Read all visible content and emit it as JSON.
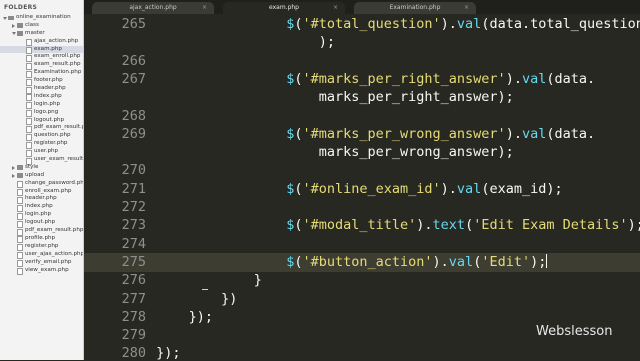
{
  "sidebar": {
    "title": "FOLDERS",
    "items": [
      {
        "label": "online_examination",
        "type": "folder",
        "expanded": true,
        "depth": 0
      },
      {
        "label": "class",
        "type": "folder",
        "expanded": false,
        "depth": 1
      },
      {
        "label": "master",
        "type": "folder",
        "expanded": true,
        "depth": 1
      },
      {
        "label": "ajax_action.php",
        "type": "file",
        "depth": 2
      },
      {
        "label": "exam.php",
        "type": "file",
        "depth": 2,
        "selected": true
      },
      {
        "label": "exam_enroll.php",
        "type": "file",
        "depth": 2
      },
      {
        "label": "exam_result.php",
        "type": "file",
        "depth": 2
      },
      {
        "label": "Examination.php",
        "type": "file",
        "depth": 2
      },
      {
        "label": "footer.php",
        "type": "file",
        "depth": 2
      },
      {
        "label": "header.php",
        "type": "file",
        "depth": 2
      },
      {
        "label": "index.php",
        "type": "file",
        "depth": 2
      },
      {
        "label": "login.php",
        "type": "file",
        "depth": 2
      },
      {
        "label": "logo.png",
        "type": "file",
        "depth": 2
      },
      {
        "label": "logout.php",
        "type": "file",
        "depth": 2
      },
      {
        "label": "pdf_exam_result.ph",
        "type": "file",
        "depth": 2
      },
      {
        "label": "question.php",
        "type": "file",
        "depth": 2
      },
      {
        "label": "register.php",
        "type": "file",
        "depth": 2
      },
      {
        "label": "user.php",
        "type": "file",
        "depth": 2
      },
      {
        "label": "user_exam_result.p",
        "type": "file",
        "depth": 2
      },
      {
        "label": "style",
        "type": "folder",
        "expanded": false,
        "depth": 1
      },
      {
        "label": "upload",
        "type": "folder",
        "expanded": false,
        "depth": 1
      },
      {
        "label": "change_password.ph",
        "type": "file",
        "depth": 1
      },
      {
        "label": "enroll_exam.php",
        "type": "file",
        "depth": 1
      },
      {
        "label": "header.php",
        "type": "file",
        "depth": 1
      },
      {
        "label": "index.php",
        "type": "file",
        "depth": 1
      },
      {
        "label": "login.php",
        "type": "file",
        "depth": 1
      },
      {
        "label": "logout.php",
        "type": "file",
        "depth": 1
      },
      {
        "label": "pdf_exam_result.php",
        "type": "file",
        "depth": 1
      },
      {
        "label": "profile.php",
        "type": "file",
        "depth": 1
      },
      {
        "label": "register.php",
        "type": "file",
        "depth": 1
      },
      {
        "label": "user_ajax_action.php",
        "type": "file",
        "depth": 1
      },
      {
        "label": "verify_email.php",
        "type": "file",
        "depth": 1
      },
      {
        "label": "view_exam.php",
        "type": "file",
        "depth": 1
      }
    ]
  },
  "tabs": [
    {
      "label": "ajax_action.php",
      "active": false
    },
    {
      "label": "exam.php",
      "active": true
    },
    {
      "label": "Examination.php",
      "active": false
    }
  ],
  "tab_close_glyph": "×",
  "editor": {
    "current_line": 275,
    "lines": [
      {
        "num": "265",
        "indent": 17,
        "tokens": [
          [
            "fn",
            "$"
          ],
          [
            "pl",
            "("
          ],
          [
            "str",
            "'#total_question'"
          ],
          [
            "pl",
            ")."
          ],
          [
            "fn",
            "val"
          ],
          [
            "pl",
            "(data.total_question"
          ]
        ]
      },
      {
        "num": "",
        "indent": 21,
        "tokens": [
          [
            "pl",
            ");"
          ]
        ]
      },
      {
        "num": "266",
        "indent": 0,
        "tokens": []
      },
      {
        "num": "267",
        "indent": 17,
        "tokens": [
          [
            "fn",
            "$"
          ],
          [
            "pl",
            "("
          ],
          [
            "str",
            "'#marks_per_right_answer'"
          ],
          [
            "pl",
            ")."
          ],
          [
            "fn",
            "val"
          ],
          [
            "pl",
            "(data."
          ]
        ]
      },
      {
        "num": "",
        "indent": 21,
        "tokens": [
          [
            "pl",
            "marks_per_right_answer);"
          ]
        ]
      },
      {
        "num": "268",
        "indent": 0,
        "tokens": []
      },
      {
        "num": "269",
        "indent": 17,
        "tokens": [
          [
            "fn",
            "$"
          ],
          [
            "pl",
            "("
          ],
          [
            "str",
            "'#marks_per_wrong_answer'"
          ],
          [
            "pl",
            ")."
          ],
          [
            "fn",
            "val"
          ],
          [
            "pl",
            "(data."
          ]
        ]
      },
      {
        "num": "",
        "indent": 21,
        "tokens": [
          [
            "pl",
            "marks_per_wrong_answer);"
          ]
        ]
      },
      {
        "num": "270",
        "indent": 0,
        "tokens": []
      },
      {
        "num": "271",
        "indent": 17,
        "tokens": [
          [
            "fn",
            "$"
          ],
          [
            "pl",
            "("
          ],
          [
            "str",
            "'#online_exam_id'"
          ],
          [
            "pl",
            ")."
          ],
          [
            "fn",
            "val"
          ],
          [
            "pl",
            "(exam_id);"
          ]
        ]
      },
      {
        "num": "272",
        "indent": 0,
        "tokens": []
      },
      {
        "num": "273",
        "indent": 17,
        "tokens": [
          [
            "fn",
            "$"
          ],
          [
            "pl",
            "("
          ],
          [
            "str",
            "'#modal_title'"
          ],
          [
            "pl",
            ")."
          ],
          [
            "fn",
            "text"
          ],
          [
            "pl",
            "("
          ],
          [
            "str",
            "'Edit Exam Details'"
          ],
          [
            "pl",
            ");"
          ]
        ]
      },
      {
        "num": "274",
        "indent": 0,
        "tokens": []
      },
      {
        "num": "275",
        "indent": 17,
        "tokens": [
          [
            "fn",
            "$"
          ],
          [
            "pl",
            "("
          ],
          [
            "str",
            "'#button_action'"
          ],
          [
            "pl",
            ")."
          ],
          [
            "fn",
            "val"
          ],
          [
            "pl",
            "("
          ],
          [
            "str",
            "'Edit'"
          ],
          [
            "pl",
            ");"
          ]
        ],
        "caret": true
      },
      {
        "num": "276",
        "indent": 13,
        "tokens": [
          [
            "pl",
            "}"
          ]
        ]
      },
      {
        "num": "277",
        "indent": 9,
        "tokens": [
          [
            "pl",
            "})"
          ]
        ]
      },
      {
        "num": "278",
        "indent": 5,
        "tokens": [
          [
            "pl",
            "});"
          ]
        ]
      },
      {
        "num": "279",
        "indent": 0,
        "tokens": []
      },
      {
        "num": "280",
        "indent": 1,
        "tokens": [
          [
            "pl",
            "});"
          ]
        ]
      }
    ]
  },
  "watermark": "Webslesson",
  "colors": {
    "background": "#272822",
    "function": "#66d9ef",
    "string": "#e6db74",
    "plain": "#f8f8f2",
    "line_number": "#8f908a",
    "sidebar_bg": "#f3f3f3",
    "selected_row": "#d6dbe3"
  }
}
